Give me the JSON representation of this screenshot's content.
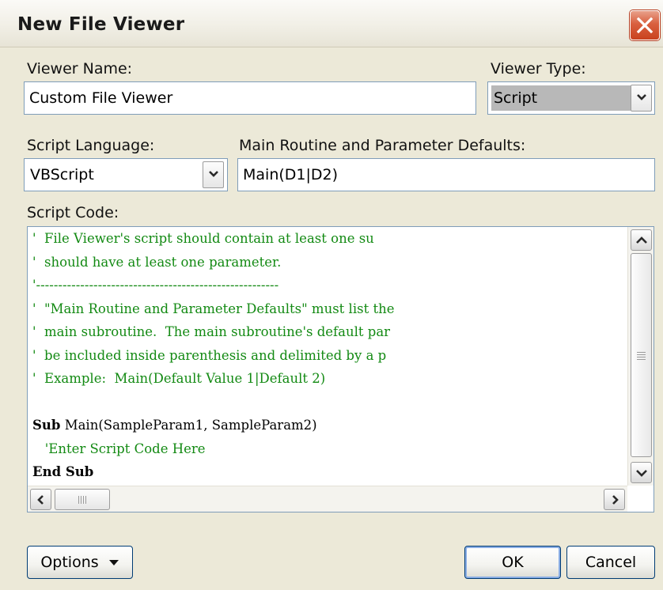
{
  "window": {
    "title": "New File Viewer"
  },
  "viewer_name": {
    "label": "Viewer Name:",
    "value": "Custom File Viewer"
  },
  "viewer_type": {
    "label": "Viewer Type:",
    "value": "Script"
  },
  "script_language": {
    "label": "Script Language:",
    "value": "VBScript"
  },
  "main_routine": {
    "label": "Main Routine and Parameter Defaults:",
    "value": "Main(D1|D2)"
  },
  "script_code": {
    "label": "Script Code:",
    "lines": [
      {
        "text": "'  File Viewer's script should contain at least one su",
        "style": "comment"
      },
      {
        "text": "'  should have at least one parameter.",
        "style": "comment"
      },
      {
        "text": "'-------------------------------------------------------",
        "style": "comment"
      },
      {
        "text": "'  \"Main Routine and Parameter Defaults\" must list the",
        "style": "comment"
      },
      {
        "text": "'  main subroutine.  The main subroutine's default par",
        "style": "comment"
      },
      {
        "text": "'  be included inside parenthesis and delimited by a p",
        "style": "comment"
      },
      {
        "text": "'  Example:  Main(Default Value 1|Default 2)",
        "style": "comment"
      },
      {
        "text": "",
        "style": "plain"
      },
      {
        "keyword": "Sub",
        "text": " Main(SampleParam1, SampleParam2)",
        "style": "plain"
      },
      {
        "text": "   'Enter Script Code Here",
        "style": "comment"
      },
      {
        "keyword": "End Sub",
        "text": "",
        "style": "plain"
      }
    ]
  },
  "buttons": {
    "options": "Options",
    "ok": "OK",
    "cancel": "Cancel"
  },
  "colors": {
    "comment": "#138a13",
    "dialog_bg": "#ece9d8",
    "close_button": "#d9603f"
  }
}
